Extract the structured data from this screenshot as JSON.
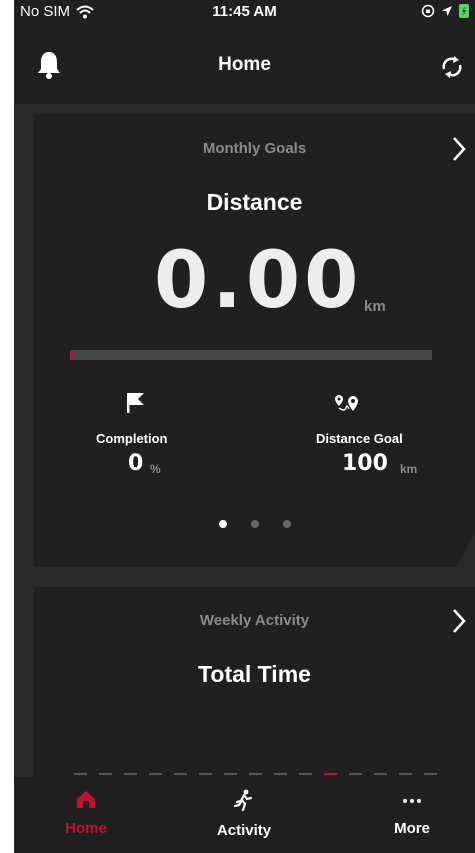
{
  "status_bar": {
    "carrier": "No SIM",
    "time": "11:45 AM"
  },
  "navbar": {
    "title": "Home",
    "left_icon": "bell-icon",
    "right_icon": "sync-icon"
  },
  "monthly_card": {
    "subtitle": "Monthly Goals",
    "heading": "Distance",
    "value": "0.00",
    "unit": "km",
    "progress_fraction": 0.0,
    "completion": {
      "label": "Completion",
      "value": "0",
      "unit": "%",
      "icon": "flag-icon"
    },
    "distance_goal": {
      "label": "Distance Goal",
      "value": "100",
      "unit": "km",
      "icon": "route-icon"
    },
    "pages": 3,
    "active_page": 0
  },
  "weekly_card": {
    "subtitle": "Weekly Activity",
    "heading": "Total Time"
  },
  "tabbar": {
    "items": [
      {
        "label": "Home",
        "icon": "home-icon",
        "active": true
      },
      {
        "label": "Activity",
        "icon": "runner-icon",
        "active": false
      },
      {
        "label": "More",
        "icon": "more-icon",
        "active": false
      }
    ]
  },
  "colors": {
    "accent": "#c8102e",
    "background": "#2a2a2a",
    "card": "#1e2120",
    "muted_text": "#8a8a8a"
  }
}
